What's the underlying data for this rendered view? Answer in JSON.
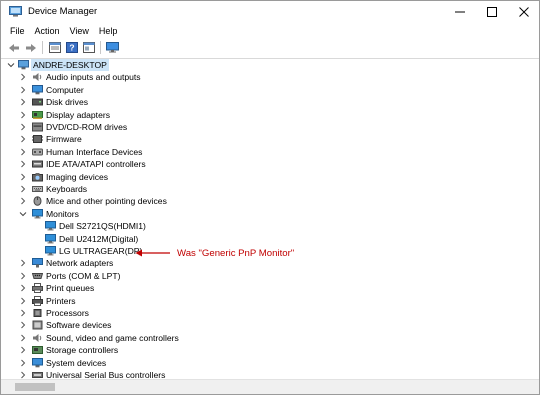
{
  "window": {
    "title": "Device Manager",
    "controls": {
      "minimize": "minimize",
      "maximize": "maximize",
      "close": "close"
    }
  },
  "menu": [
    "File",
    "Action",
    "View",
    "Help"
  ],
  "toolbar": [
    "back-icon",
    "forward-icon",
    "properties-icon",
    "help-icon",
    "update-icon",
    "monitor-icon"
  ],
  "tree": {
    "root": {
      "label": "ANDRE-DESKTOP",
      "icon": "computer-icon"
    },
    "items": [
      {
        "label": "Audio inputs and outputs",
        "icon": "speaker-icon",
        "expanded": false
      },
      {
        "label": "Computer",
        "icon": "computer-icon",
        "expanded": false
      },
      {
        "label": "Disk drives",
        "icon": "disk-icon",
        "expanded": false
      },
      {
        "label": "Display adapters",
        "icon": "display-adapter-icon",
        "expanded": false
      },
      {
        "label": "DVD/CD-ROM drives",
        "icon": "dvd-icon",
        "expanded": false
      },
      {
        "label": "Firmware",
        "icon": "firmware-icon",
        "expanded": false
      },
      {
        "label": "Human Interface Devices",
        "icon": "hid-icon",
        "expanded": false
      },
      {
        "label": "IDE ATA/ATAPI controllers",
        "icon": "ide-icon",
        "expanded": false
      },
      {
        "label": "Imaging devices",
        "icon": "camera-icon",
        "expanded": false
      },
      {
        "label": "Keyboards",
        "icon": "keyboard-icon",
        "expanded": false
      },
      {
        "label": "Mice and other pointing devices",
        "icon": "mouse-icon",
        "expanded": false
      },
      {
        "label": "Monitors",
        "icon": "monitor-icon",
        "expanded": true,
        "children": [
          {
            "label": "Dell S2721QS(HDMI1)",
            "icon": "monitor-icon"
          },
          {
            "label": "Dell U2412M(Digital)",
            "icon": "monitor-icon"
          },
          {
            "label": "LG ULTRAGEAR(DP)",
            "icon": "monitor-icon"
          }
        ]
      },
      {
        "label": "Network adapters",
        "icon": "network-icon",
        "expanded": false
      },
      {
        "label": "Ports (COM & LPT)",
        "icon": "port-icon",
        "expanded": false
      },
      {
        "label": "Print queues",
        "icon": "printer-icon",
        "expanded": false
      },
      {
        "label": "Printers",
        "icon": "printer-icon",
        "expanded": false
      },
      {
        "label": "Processors",
        "icon": "processor-icon",
        "expanded": false
      },
      {
        "label": "Software devices",
        "icon": "software-icon",
        "expanded": false
      },
      {
        "label": "Sound, video and game controllers",
        "icon": "speaker-icon",
        "expanded": false
      },
      {
        "label": "Storage controllers",
        "icon": "storage-icon",
        "expanded": false
      },
      {
        "label": "System devices",
        "icon": "system-icon",
        "expanded": false
      },
      {
        "label": "Universal Serial Bus controllers",
        "icon": "usb-icon",
        "expanded": false
      }
    ]
  },
  "annotation": {
    "text": "Was \"Generic PnP Monitor\"",
    "color": "#c00000"
  },
  "colors": {
    "selection": "#cce4f7",
    "monitor_blue": "#2f8fd8",
    "annotation_red": "#c00000"
  }
}
